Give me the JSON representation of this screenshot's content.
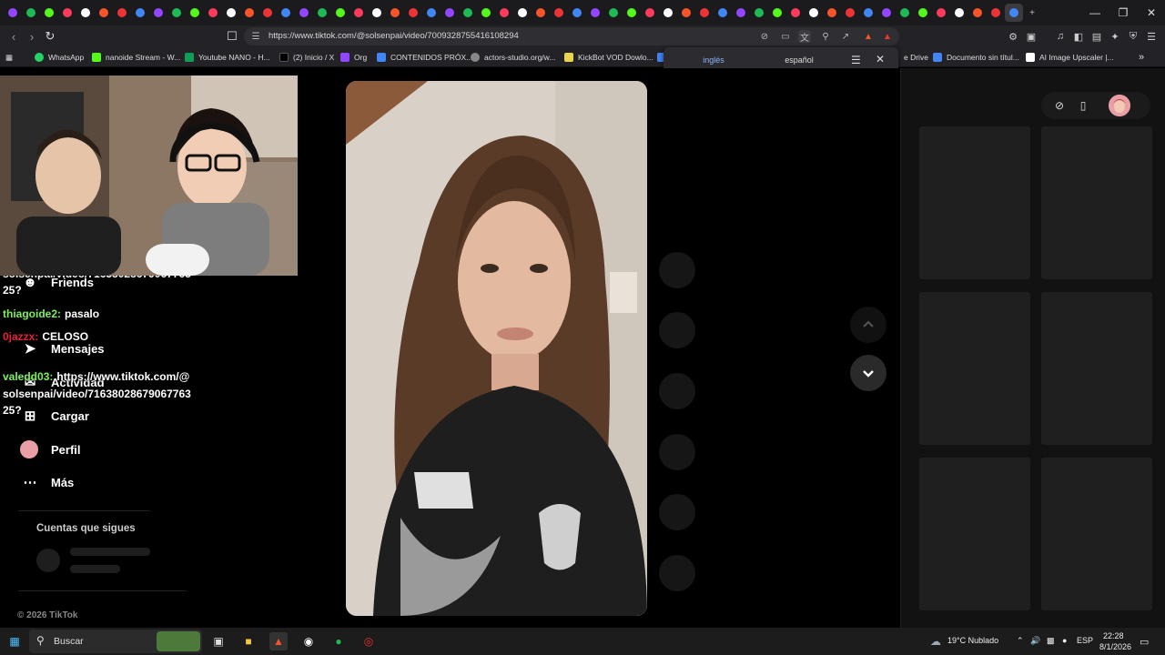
{
  "browser": {
    "url": "https://www.tiktok.com/@solsenpai/video/7009328755416108294",
    "bookmarks": [
      {
        "label": "WhatsApp",
        "color": "#25d366"
      },
      {
        "label": "nanoide Stream - W...",
        "color": "#444444"
      },
      {
        "label": "Youtube NANO - H...",
        "color": "#0f9d58"
      },
      {
        "label": "(2) Inicio / X",
        "color": "#000000"
      },
      {
        "label": "Org",
        "color": "#9146ff"
      },
      {
        "label": "CONTENIDOS PRÓX...",
        "color": "#4285f4"
      },
      {
        "label": "actors-studio.org/w...",
        "color": "#888888"
      },
      {
        "label": "KickBot VOD Dowlo...",
        "color": "#e8d44d"
      },
      {
        "label": "e Drive",
        "color": "#4285f4"
      },
      {
        "label": "Documento sin títul...",
        "color": "#4285f4"
      },
      {
        "label": "AI Image Upscaler |...",
        "color": "#ffffff"
      }
    ],
    "translate_popup": {
      "source_lang": "inglés",
      "target_lang": "español"
    }
  },
  "sidebar": {
    "items": [
      {
        "label": "Friends",
        "icon": "friends-icon"
      },
      {
        "label": "Mensajes",
        "icon": "send-icon"
      },
      {
        "label": "Actividad",
        "icon": "activity-icon"
      },
      {
        "label": "Cargar",
        "icon": "plus-square-icon"
      },
      {
        "label": "Perfil",
        "icon": "avatar"
      },
      {
        "label": "Más",
        "icon": "more-icon"
      }
    ],
    "following_title": "Cuentas que sigues",
    "copyright": "© 2026 TikTok"
  },
  "chat": [
    {
      "user": "",
      "message": "solsenpai/video/71638028679067763",
      "color": "#ffffff"
    },
    {
      "user": "",
      "message": "25?",
      "color": "#ffffff"
    },
    {
      "user": "thiagoide2:",
      "message": "pasalo",
      "color": "#7cf05a"
    },
    {
      "user": "0jazzx:",
      "message": "CELOSO",
      "color": "#e8203a"
    },
    {
      "user": "valedd03:",
      "message": "https://www.tiktok.com/@",
      "color": "#7cf05a"
    },
    {
      "user": "",
      "message": "solsenpai/video/71638028679067763",
      "color": "#ffffff"
    },
    {
      "user": "",
      "message": "25?",
      "color": "#ffffff"
    }
  ],
  "taskbar": {
    "search_placeholder": "Buscar",
    "weather": "19°C  Nublado",
    "lang": "ESP",
    "time": "22:28",
    "date": "8/1/2026"
  },
  "colors": {
    "accent": "#8ab4f8",
    "bg": "#000000",
    "panel": "#121212"
  }
}
